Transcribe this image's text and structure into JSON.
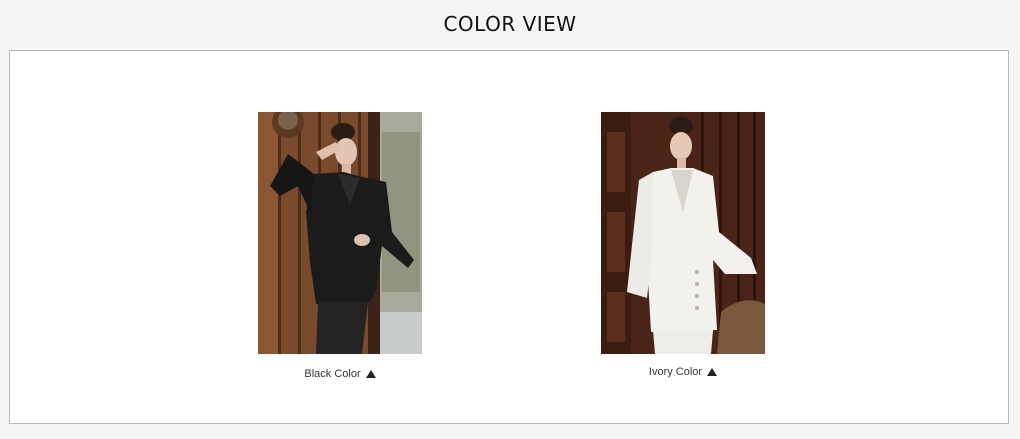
{
  "section": {
    "title": "COLOR VIEW"
  },
  "colors": [
    {
      "label": "Black Color",
      "indicator_icon": "triangle-up-icon",
      "swatch": "#1b1b1b"
    },
    {
      "label": "Ivory Color",
      "indicator_icon": "triangle-up-icon",
      "swatch": "#f3f1ec"
    }
  ]
}
